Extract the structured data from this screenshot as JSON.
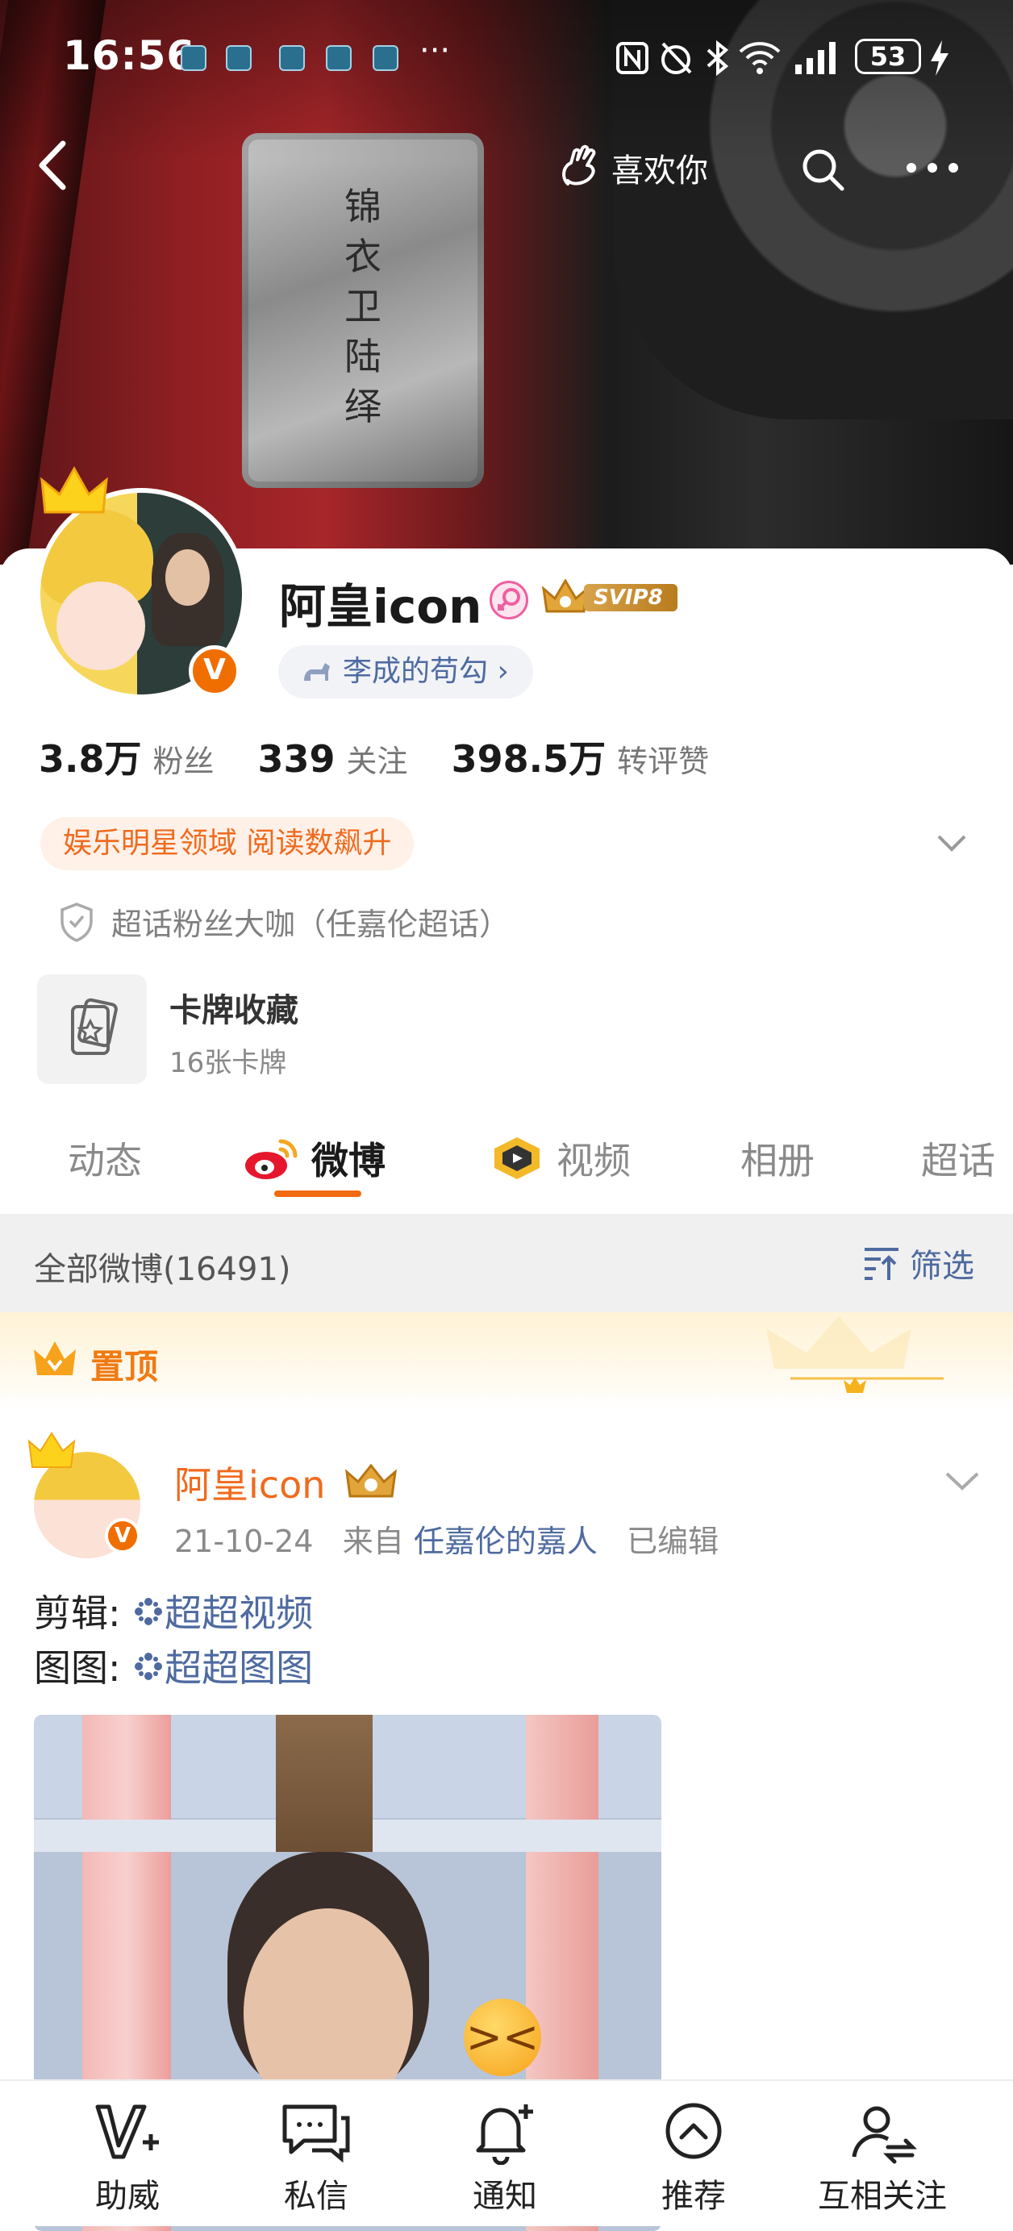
{
  "status_bar": {
    "time": "16:56",
    "dots": "···",
    "battery": "53"
  },
  "header": {
    "like_you_label": "喜欢你"
  },
  "cover": {
    "tag_text": "锦衣卫陆绎"
  },
  "profile": {
    "name": "阿皇icon",
    "svip_label": "SVIP8",
    "fan_tag": "李成的苟勾 ›",
    "stats": [
      {
        "value": "3.8万",
        "label": "粉丝"
      },
      {
        "value": "339",
        "label": "关注"
      },
      {
        "value": "398.5万",
        "label": "转评赞"
      }
    ],
    "field_badge": "娱乐明星领域 阅读数飙升",
    "super_fan": "超话粉丝大咖（任嘉伦超话）",
    "card_title": "卡牌收藏",
    "card_sub": "16张卡牌",
    "verified_mark": "V"
  },
  "tabs": [
    {
      "label": "动态"
    },
    {
      "label": "微博"
    },
    {
      "label": "视频"
    },
    {
      "label": "相册"
    },
    {
      "label": "超话"
    }
  ],
  "filter": {
    "all_label": "全部微博(16491)",
    "filter_label": "筛选"
  },
  "pinned_label": "置顶",
  "post": {
    "author": "阿皇icon",
    "date": "21-10-24",
    "from": "来自",
    "source": "任嘉伦的嘉人",
    "edited": "已编辑",
    "line1_prefix": "剪辑:",
    "line1_topic": "超超视频",
    "line2_prefix": "图图:",
    "line2_topic": "超超图图"
  },
  "bottom_nav": [
    {
      "label": "助威"
    },
    {
      "label": "私信"
    },
    {
      "label": "通知"
    },
    {
      "label": "推荐"
    },
    {
      "label": "互相关注"
    }
  ],
  "colors": {
    "accent_orange": "#f26a10",
    "link_blue": "#4e6aa0"
  }
}
